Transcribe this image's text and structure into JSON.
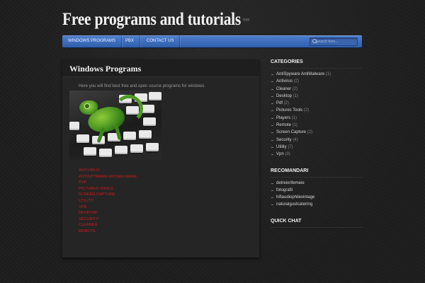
{
  "header": {
    "site_title": "Free programs and tutorials",
    "tagline": "FREE"
  },
  "nav": {
    "items": [
      "WINDOWS PROGRAMS",
      "PBX",
      "CONTACT US"
    ],
    "search_placeholder": "search here..."
  },
  "post": {
    "title": "Windows Programs",
    "intro": "Here you will find best free and open source programs for windows.",
    "image_icon": "chameleon-on-keyboard-photo",
    "category_links": [
      "ANTIVIRUS",
      "ANTISPYWARE ANTIMALWARE",
      "PDF",
      "PICTURES TOOLS",
      "SCREEN CAPTURE",
      "UTILITY",
      "VPN",
      "DESKTOP",
      "SECURITY",
      "CLEANER",
      "REMOTE"
    ],
    "link_color": "#d01a1a"
  },
  "sidebar": {
    "categories_title": "CATEGORIES",
    "categories": [
      {
        "name": "AntiSpyware AntiMalware",
        "count": "(1)"
      },
      {
        "name": "Antivirus",
        "count": "(2)"
      },
      {
        "name": "Cleaner",
        "count": "(2)"
      },
      {
        "name": "Desktop",
        "count": "(1)"
      },
      {
        "name": "Pdf",
        "count": "(2)"
      },
      {
        "name": "Pictures Tools",
        "count": "(2)"
      },
      {
        "name": "Players",
        "count": "(1)"
      },
      {
        "name": "Remote",
        "count": "(1)"
      },
      {
        "name": "Screen Capture",
        "count": "(2)"
      },
      {
        "name": "Security",
        "count": "(4)"
      },
      {
        "name": "Utility",
        "count": "(7)"
      },
      {
        "name": "Vpn",
        "count": "(3)"
      }
    ],
    "recomandari_title": "RECOMANDARI",
    "recomandari": [
      "detreiorifemeie",
      "fotografii",
      "hifiaudiophilevintage",
      "naturalgustcatering"
    ],
    "quickchat_title": "QUICK CHAT"
  },
  "colors": {
    "background": "#1d1d1d",
    "nav_accent": "#3a6bbd",
    "content_panel": "#252525"
  }
}
